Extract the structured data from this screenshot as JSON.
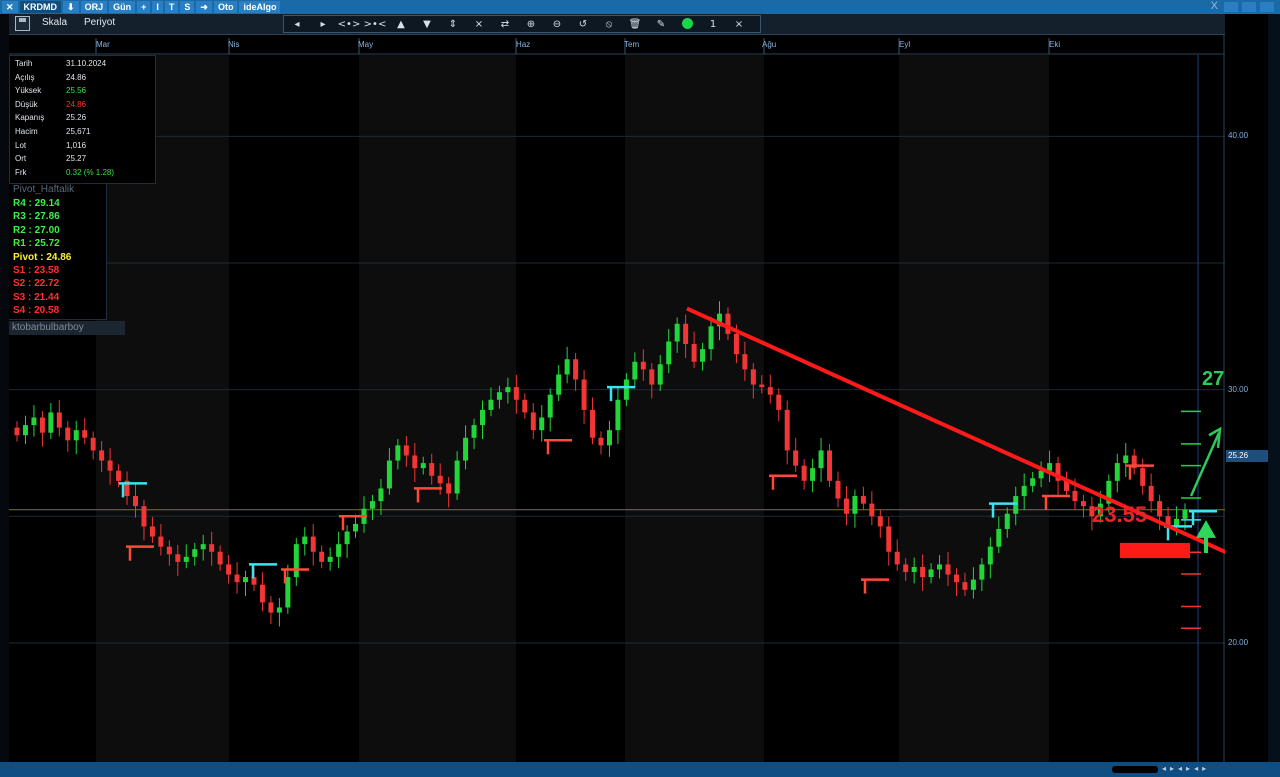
{
  "titlebar": {
    "symbol": "KRDMD",
    "buttons": [
      "ORJ",
      "Gün",
      "+",
      "I",
      "T",
      "S",
      "Oto",
      "ideAlgo"
    ],
    "close_glyph": "X"
  },
  "toolbar": {
    "scale_label": "Skala",
    "period_label": "Periyot",
    "tools": [
      "arrow-left",
      "arrow-right",
      "expand-horizontal",
      "shrink-horizontal",
      "arrow-up",
      "arrow-down",
      "expand-vertical",
      "shrink-vertical",
      "swap",
      "zoom-in",
      "zoom-out",
      "reset",
      "no-entry",
      "trash",
      "pen",
      "green-dot",
      "count",
      "close"
    ],
    "tool_glyphs": [
      "◂",
      "▸",
      "<•>",
      ">•<",
      "▲",
      "▼",
      "⇕",
      "⨯",
      "⇄",
      "⊕",
      "⊖",
      "↺",
      "⦸",
      "🗑",
      "✎",
      "",
      "1",
      "×"
    ]
  },
  "chart_data": {
    "type": "candlestick",
    "symbol": "KRDMD",
    "months": [
      "Mar",
      "Nis",
      "May",
      "Haz",
      "Tem",
      "Ağu",
      "Eyl",
      "Eki"
    ],
    "y_ticks": [
      40.0,
      30.0,
      20.0
    ],
    "ylim": [
      15.3,
      44.0
    ],
    "current_price": 25.26,
    "closes": [
      28.2,
      28.6,
      28.9,
      28.3,
      29.1,
      28.5,
      28.0,
      28.4,
      28.1,
      27.6,
      27.2,
      26.8,
      26.4,
      25.8,
      25.4,
      24.6,
      24.2,
      23.8,
      23.5,
      23.2,
      23.4,
      23.7,
      23.9,
      23.6,
      23.1,
      22.7,
      22.4,
      22.6,
      22.3,
      21.6,
      21.2,
      21.4,
      22.6,
      23.9,
      24.2,
      23.6,
      23.2,
      23.4,
      23.9,
      24.4,
      24.7,
      25.3,
      25.6,
      26.1,
      27.2,
      27.8,
      27.4,
      26.9,
      27.1,
      26.6,
      26.3,
      25.9,
      27.2,
      28.1,
      28.6,
      29.2,
      29.6,
      29.9,
      30.1,
      29.6,
      29.1,
      28.4,
      28.9,
      29.8,
      30.6,
      31.2,
      30.4,
      29.2,
      28.1,
      27.8,
      28.4,
      29.6,
      30.4,
      31.1,
      30.8,
      30.2,
      31.0,
      31.9,
      32.6,
      31.8,
      31.1,
      31.6,
      32.5,
      33.0,
      32.2,
      31.4,
      30.8,
      30.2,
      30.1,
      29.8,
      29.2,
      27.6,
      27.0,
      26.4,
      26.9,
      27.6,
      26.4,
      25.7,
      25.1,
      25.8,
      25.5,
      25.0,
      24.6,
      23.6,
      23.1,
      22.8,
      23.0,
      22.6,
      22.9,
      23.1,
      22.7,
      22.4,
      22.1,
      22.5,
      23.1,
      23.8,
      24.5,
      25.1,
      25.8,
      26.2,
      26.5,
      26.8,
      27.1,
      26.4,
      26.0,
      25.6,
      25.4,
      25.0,
      25.5,
      26.4,
      27.1,
      27.4,
      26.9,
      26.2,
      25.6,
      25.0,
      24.6,
      24.9,
      25.26
    ],
    "pivot_levels": [
      29.14,
      27.86,
      27.0,
      25.72,
      24.86,
      23.58,
      22.72,
      21.44,
      20.58
    ],
    "trendline": {
      "start_price": 33.2,
      "end_price": 22.9
    }
  },
  "info_panel": {
    "rows": [
      {
        "key": "Tarih",
        "value": "31.10.2024",
        "color": "#dfe6ec"
      },
      {
        "key": "Açılış",
        "value": "24.86",
        "color": "#dfe6ec"
      },
      {
        "key": "Yüksek",
        "value": "25.56",
        "color": "#3be04a"
      },
      {
        "key": "Düşük",
        "value": "24.86",
        "color": "#ff3030"
      },
      {
        "key": "Kapanış",
        "value": "25.26",
        "color": "#dfe6ec"
      },
      {
        "key": "Hacim",
        "value": "25,671",
        "color": "#dfe6ec"
      },
      {
        "key": "Lot",
        "value": "1,016",
        "color": "#dfe6ec"
      },
      {
        "key": "Ort",
        "value": "25.27",
        "color": "#dfe6ec"
      },
      {
        "key": "Frk",
        "value": "0.32 (% 1.28)",
        "color": "#3be04a"
      }
    ]
  },
  "pivot_panel": {
    "title": "Pivot_Haftalik",
    "rows": [
      {
        "label": "R4 :  29.14",
        "color": "#3bf04a"
      },
      {
        "label": "R3 :  27.86",
        "color": "#3bf04a"
      },
      {
        "label": "R2 :  27.00",
        "color": "#3bf04a"
      },
      {
        "label": "R1 :  25.72",
        "color": "#3bf04a"
      },
      {
        "label": "Pivot :  24.86",
        "color": "#f8f03a"
      },
      {
        "label": "S1 :  23.58",
        "color": "#ff3030"
      },
      {
        "label": "S2 :  22.72",
        "color": "#ff3030"
      },
      {
        "label": "S3 :  21.44",
        "color": "#ff3030"
      },
      {
        "label": "S4 :  20.58",
        "color": "#ff3030"
      }
    ]
  },
  "indicator_tag": "ktobarbulbarboy",
  "annotations": {
    "target": "27",
    "support": "23.55"
  },
  "axis": {
    "y_labels": [
      "40.00",
      "30.00",
      "20.00"
    ],
    "price_tag": "25.26"
  },
  "colors": {
    "up": "#22d63a",
    "down": "#f23535",
    "trend": "#ff1a1a",
    "pivot_marker": "#39e6f0",
    "grid": "#1a2a3a"
  }
}
